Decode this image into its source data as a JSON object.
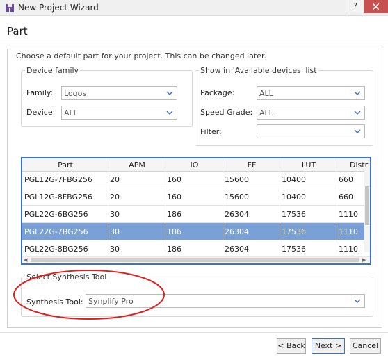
{
  "window": {
    "title": "New Project Wizard",
    "help_label": "?"
  },
  "page": {
    "title": "Part",
    "subtitle": "Choose a default part for your project. This can be changed later."
  },
  "device_family": {
    "legend": "Device family",
    "family_label": "Family:",
    "family_value": "Logos",
    "device_label": "Device:",
    "device_value": "ALL"
  },
  "available_devices": {
    "legend": "Show in 'Available devices' list",
    "package_label": "Package:",
    "package_value": "ALL",
    "speed_grade_label": "Speed Grade:",
    "speed_grade_value": "ALL",
    "filter_label": "Filter:",
    "filter_value": ""
  },
  "parts_table": {
    "columns": [
      "Part",
      "APM",
      "IO",
      "FF",
      "LUT",
      "Distr"
    ],
    "rows": [
      [
        "PGL12G-7FBG256",
        "20",
        "160",
        "15600",
        "10400",
        "660"
      ],
      [
        "PGL12G-8FBG256",
        "20",
        "160",
        "15600",
        "10400",
        "660"
      ],
      [
        "PGL22G-6BG256",
        "30",
        "186",
        "26304",
        "17536",
        "1110"
      ],
      [
        "PGL22G-7BG256",
        "30",
        "186",
        "26304",
        "17536",
        "1110"
      ],
      [
        "PGL22G-8BG256",
        "30",
        "186",
        "26304",
        "17536",
        "1110"
      ]
    ],
    "selected_row": 3
  },
  "synthesis": {
    "legend": "Select Synthesis Tool",
    "tool_label": "Synthesis Tool:",
    "tool_value": "Synplify Pro"
  },
  "buttons": {
    "back": "< Back",
    "next": "Next >",
    "cancel": "Cancel"
  },
  "colors": {
    "accent": "#3b73c4",
    "selected_row": "#79a1d8",
    "annotation": "#e02020",
    "close": "#c75050"
  }
}
